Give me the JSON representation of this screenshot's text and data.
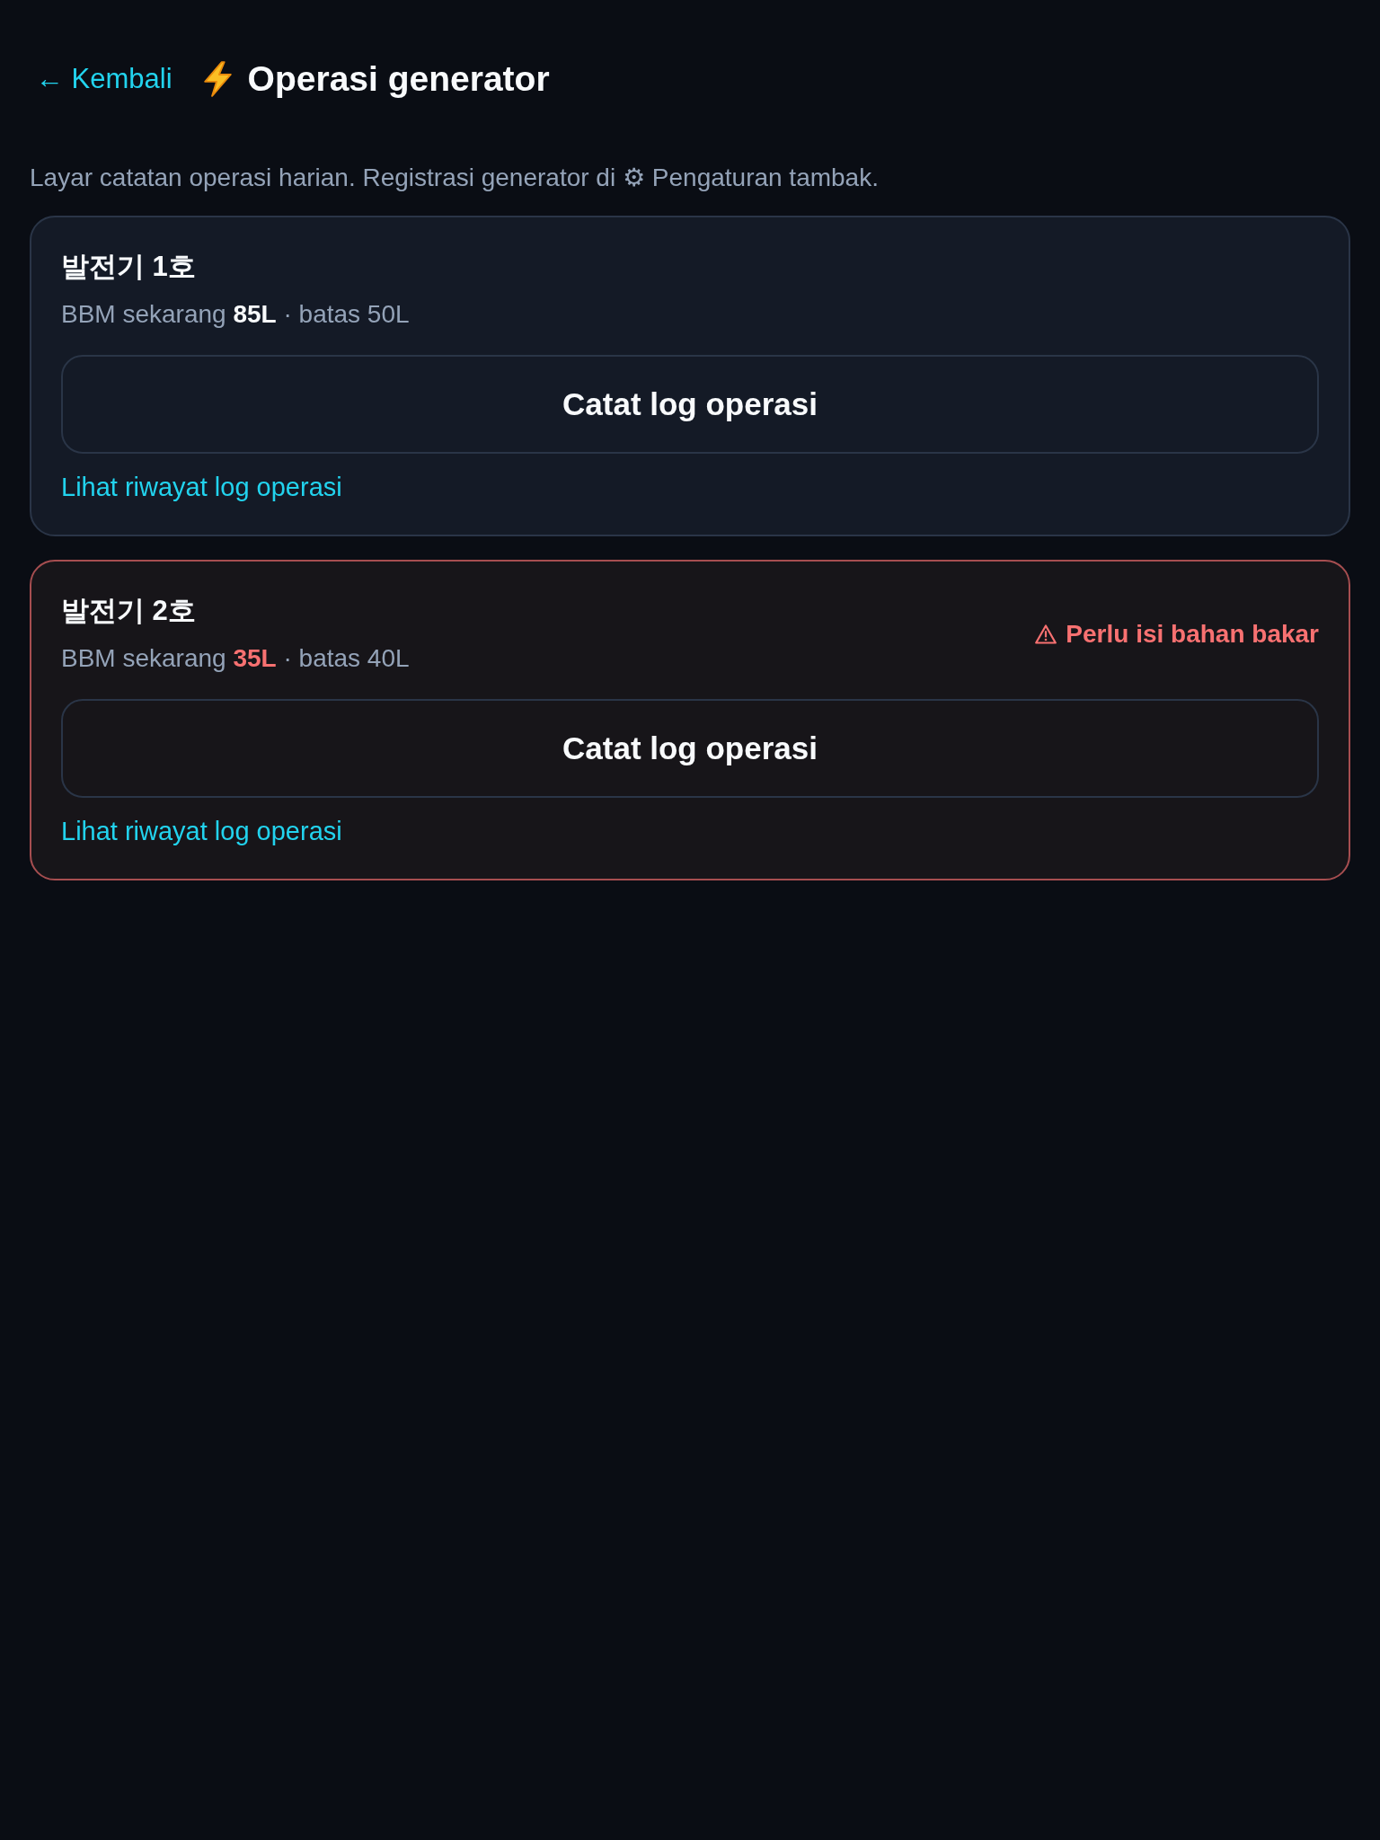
{
  "header": {
    "back_link": "← Kembali",
    "title": "Operasi generator"
  },
  "description": "Layar catatan operasi harian. Registrasi generator di ⚙ Pengaturan tambak.",
  "generators": [
    {
      "name": "발전기 1호",
      "fuel_status": "BBM sekarang **85L** · batas 50L",
      "low_fuel": false,
      "action": "Catat log operasi",
      "history_link": "Lihat riwayat log operasi"
    },
    {
      "name": "발전기 2호",
      "fuel_status": "BBM sekarang **35L** · batas 40L",
      "low_fuel": true,
      "warning": "Perlu isi bahan bakar",
      "action": "Catat log operasi",
      "history_link": "Lihat riwayat log operasi"
    }
  ]
}
